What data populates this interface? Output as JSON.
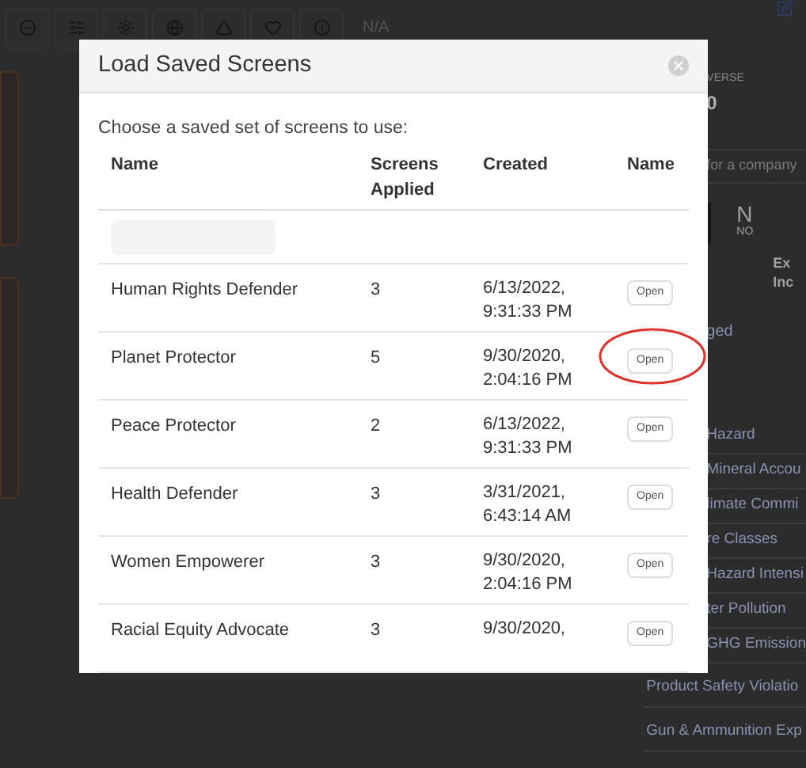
{
  "toolbar": {
    "last_label": "N/A"
  },
  "side_panel": {
    "header": "VERSE",
    "value": "0",
    "search_placeholder": "for a company",
    "card_title": "N",
    "card_sub": "NO",
    "lines": [
      "Ex",
      "Inc"
    ],
    "tag": "ged"
  },
  "list": [
    {
      "label": "Hazard",
      "kind": "clipped"
    },
    {
      "label": "Mineral Accou",
      "kind": "clipped"
    },
    {
      "label": "limate Commi",
      "kind": "clipped"
    },
    {
      "label": "re Classes",
      "kind": "clipped"
    },
    {
      "label": "Hazard Intensi",
      "kind": "clipped"
    },
    {
      "label": "ter Pollution",
      "kind": "clipped"
    },
    {
      "label": "GHG Emission",
      "kind": "clipped"
    },
    {
      "label": "Product Safety Violatio",
      "kind": "full"
    },
    {
      "label": "Gun & Ammunition Exp",
      "kind": "full"
    }
  ],
  "dialog": {
    "title": "Load Saved Screens",
    "intro": "Choose a saved set of screens to use:",
    "columns": [
      "Name",
      "Screens Applied",
      "Created",
      "Name"
    ],
    "rows": [
      {
        "name": "Human Rights Defender",
        "screens": "3",
        "created": "6/13/2022, 9:31:33 PM",
        "action": "Open",
        "highlighted": false
      },
      {
        "name": "Planet Protector",
        "screens": "5",
        "created": "9/30/2020, 2:04:16 PM",
        "action": "Open",
        "highlighted": true
      },
      {
        "name": "Peace Protector",
        "screens": "2",
        "created": "6/13/2022, 9:31:33 PM",
        "action": "Open",
        "highlighted": false
      },
      {
        "name": "Health Defender",
        "screens": "3",
        "created": "3/31/2021, 6:43:14 AM",
        "action": "Open",
        "highlighted": false
      },
      {
        "name": "Women Empowerer",
        "screens": "3",
        "created": "9/30/2020, 2:04:16 PM",
        "action": "Open",
        "highlighted": false
      },
      {
        "name": "Racial Equity Advocate",
        "screens": "3",
        "created": "9/30/2020,",
        "action": "Open",
        "highlighted": false
      }
    ]
  }
}
